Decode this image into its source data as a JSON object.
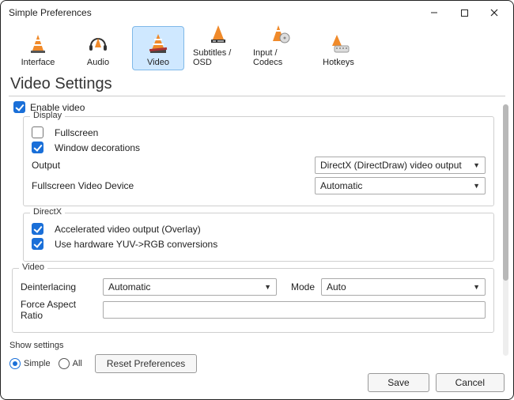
{
  "window": {
    "title": "Simple Preferences"
  },
  "tabs": {
    "interface": "Interface",
    "audio": "Audio",
    "video": "Video",
    "subtitles": "Subtitles / OSD",
    "input": "Input / Codecs",
    "hotkeys": "Hotkeys"
  },
  "heading": "Video Settings",
  "enable_video": "Enable video",
  "display": {
    "legend": "Display",
    "fullscreen": "Fullscreen",
    "window_decorations": "Window decorations",
    "output_label": "Output",
    "output_value": "DirectX (DirectDraw) video output",
    "fsdev_label": "Fullscreen Video Device",
    "fsdev_value": "Automatic"
  },
  "directx": {
    "legend": "DirectX",
    "accel": "Accelerated video output (Overlay)",
    "yuv": "Use hardware YUV->RGB conversions"
  },
  "videogrp": {
    "legend": "Video",
    "deint_label": "Deinterlacing",
    "deint_value": "Automatic",
    "mode_label": "Mode",
    "mode_value": "Auto",
    "far_label": "Force Aspect Ratio",
    "far_value": ""
  },
  "bottom": {
    "show_settings": "Show settings",
    "simple": "Simple",
    "all": "All",
    "reset": "Reset Preferences",
    "save": "Save",
    "cancel": "Cancel"
  }
}
